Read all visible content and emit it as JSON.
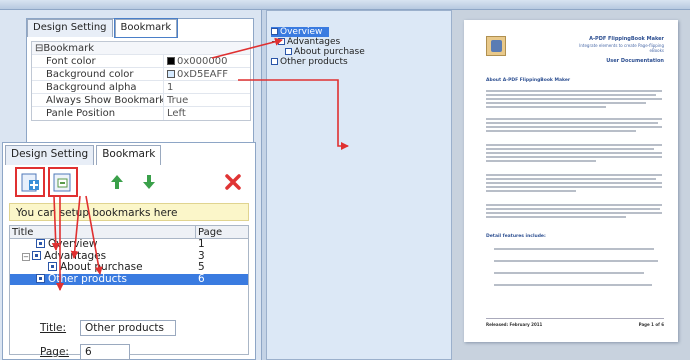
{
  "design_panel": {
    "tabs": [
      "Design Setting",
      "Bookmark"
    ],
    "group": "Bookmark",
    "group_expander": "⊟",
    "props": [
      {
        "key": "Font color",
        "value": "0x000000",
        "swatch": "#000000"
      },
      {
        "key": "Background color",
        "value": "0xD5EAFF",
        "swatch": "#d5eaff"
      },
      {
        "key": "Background alpha",
        "value": "1"
      },
      {
        "key": "Always Show Bookmark",
        "value": "True"
      },
      {
        "key": "Panle Position",
        "value": "Left"
      }
    ]
  },
  "bookmark_panel": {
    "tabs": [
      "Design Setting",
      "Bookmark"
    ],
    "toolbar": {
      "add": "add-bookmark",
      "add_child": "add-child-bookmark",
      "up": "move-up",
      "down": "move-down",
      "delete": "delete-bookmark"
    },
    "hint": "You can setup bookmarks here",
    "columns": {
      "title": "Title",
      "page": "Page"
    },
    "rows": [
      {
        "title": "Overview",
        "page": "1"
      },
      {
        "title": "Advantages",
        "page": "3"
      },
      {
        "title": "About purchase",
        "page": "5"
      },
      {
        "title": "Other products",
        "page": "6"
      }
    ],
    "title_label": "Title:",
    "title_value": "Other products",
    "page_label": "Page:",
    "page_value": "6"
  },
  "preview_tree": {
    "items": [
      "Overview",
      "Advantages",
      "About purchase",
      "Other products"
    ],
    "expander": "−"
  },
  "document": {
    "title": "A-PDF FlippingBook Maker",
    "subtitle1": "Integrate elements to create Page-flipping",
    "subtitle2": "eBooks",
    "user_doc": "User Documentation",
    "heading1": "About A-PDF FlippingBook Maker",
    "heading2": "Detail features include:",
    "footer_left": "Released: February 2011",
    "footer_right": "Page 1 of 6"
  },
  "colors": {
    "arrow": "#e03030",
    "selection": "#3a7be0",
    "panel_bg": "#dce8f6"
  }
}
